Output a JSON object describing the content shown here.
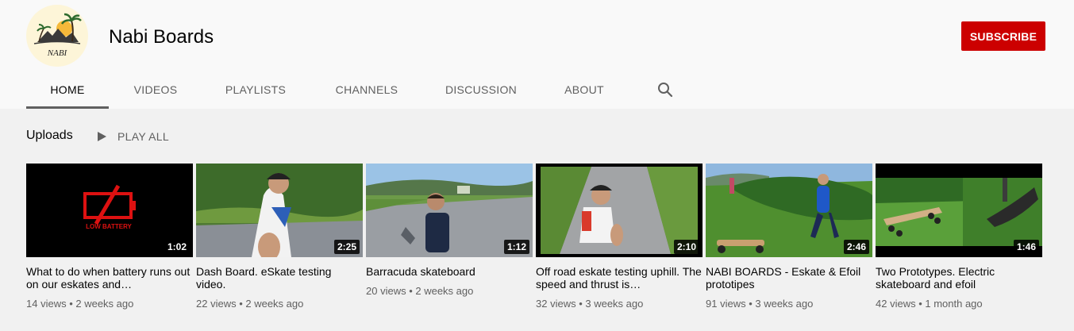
{
  "channel": {
    "name": "Nabi Boards",
    "avatar_text": "NABI",
    "subscribe_label": "SUBSCRIBE"
  },
  "tabs": [
    {
      "label": "HOME",
      "active": true
    },
    {
      "label": "VIDEOS"
    },
    {
      "label": "PLAYLISTS"
    },
    {
      "label": "CHANNELS"
    },
    {
      "label": "DISCUSSION"
    },
    {
      "label": "ABOUT"
    }
  ],
  "search_icon": "search-icon",
  "uploads": {
    "title": "Uploads",
    "play_all_label": "PLAY ALL"
  },
  "videos": [
    {
      "title": "What to do when battery runs out on our eskates and…",
      "duration": "1:02",
      "views": "14 views",
      "age": "2 weeks ago",
      "thumb_text": "LOW BATTERY"
    },
    {
      "title": "Dash Board. eSkate testing video.",
      "duration": "2:25",
      "views": "22 views",
      "age": "2 weeks ago"
    },
    {
      "title": "Barracuda skateboard",
      "duration": "1:12",
      "views": "20 views",
      "age": "2 weeks ago"
    },
    {
      "title": "Off road eskate testing uphill. The speed and thrust is…",
      "duration": "2:10",
      "views": "32 views",
      "age": "3 weeks ago"
    },
    {
      "title": "NABI BOARDS - Eskate & Efoil prototipes",
      "duration": "2:46",
      "views": "91 views",
      "age": "3 weeks ago"
    },
    {
      "title": "Two Prototypes. Electric skateboard and efoil",
      "duration": "1:46",
      "views": "42 views",
      "age": "1 month ago"
    }
  ],
  "colors": {
    "subscribe": "#cc0000",
    "header_bg": "#f9f9f9",
    "content_bg": "#f1f1f1"
  }
}
